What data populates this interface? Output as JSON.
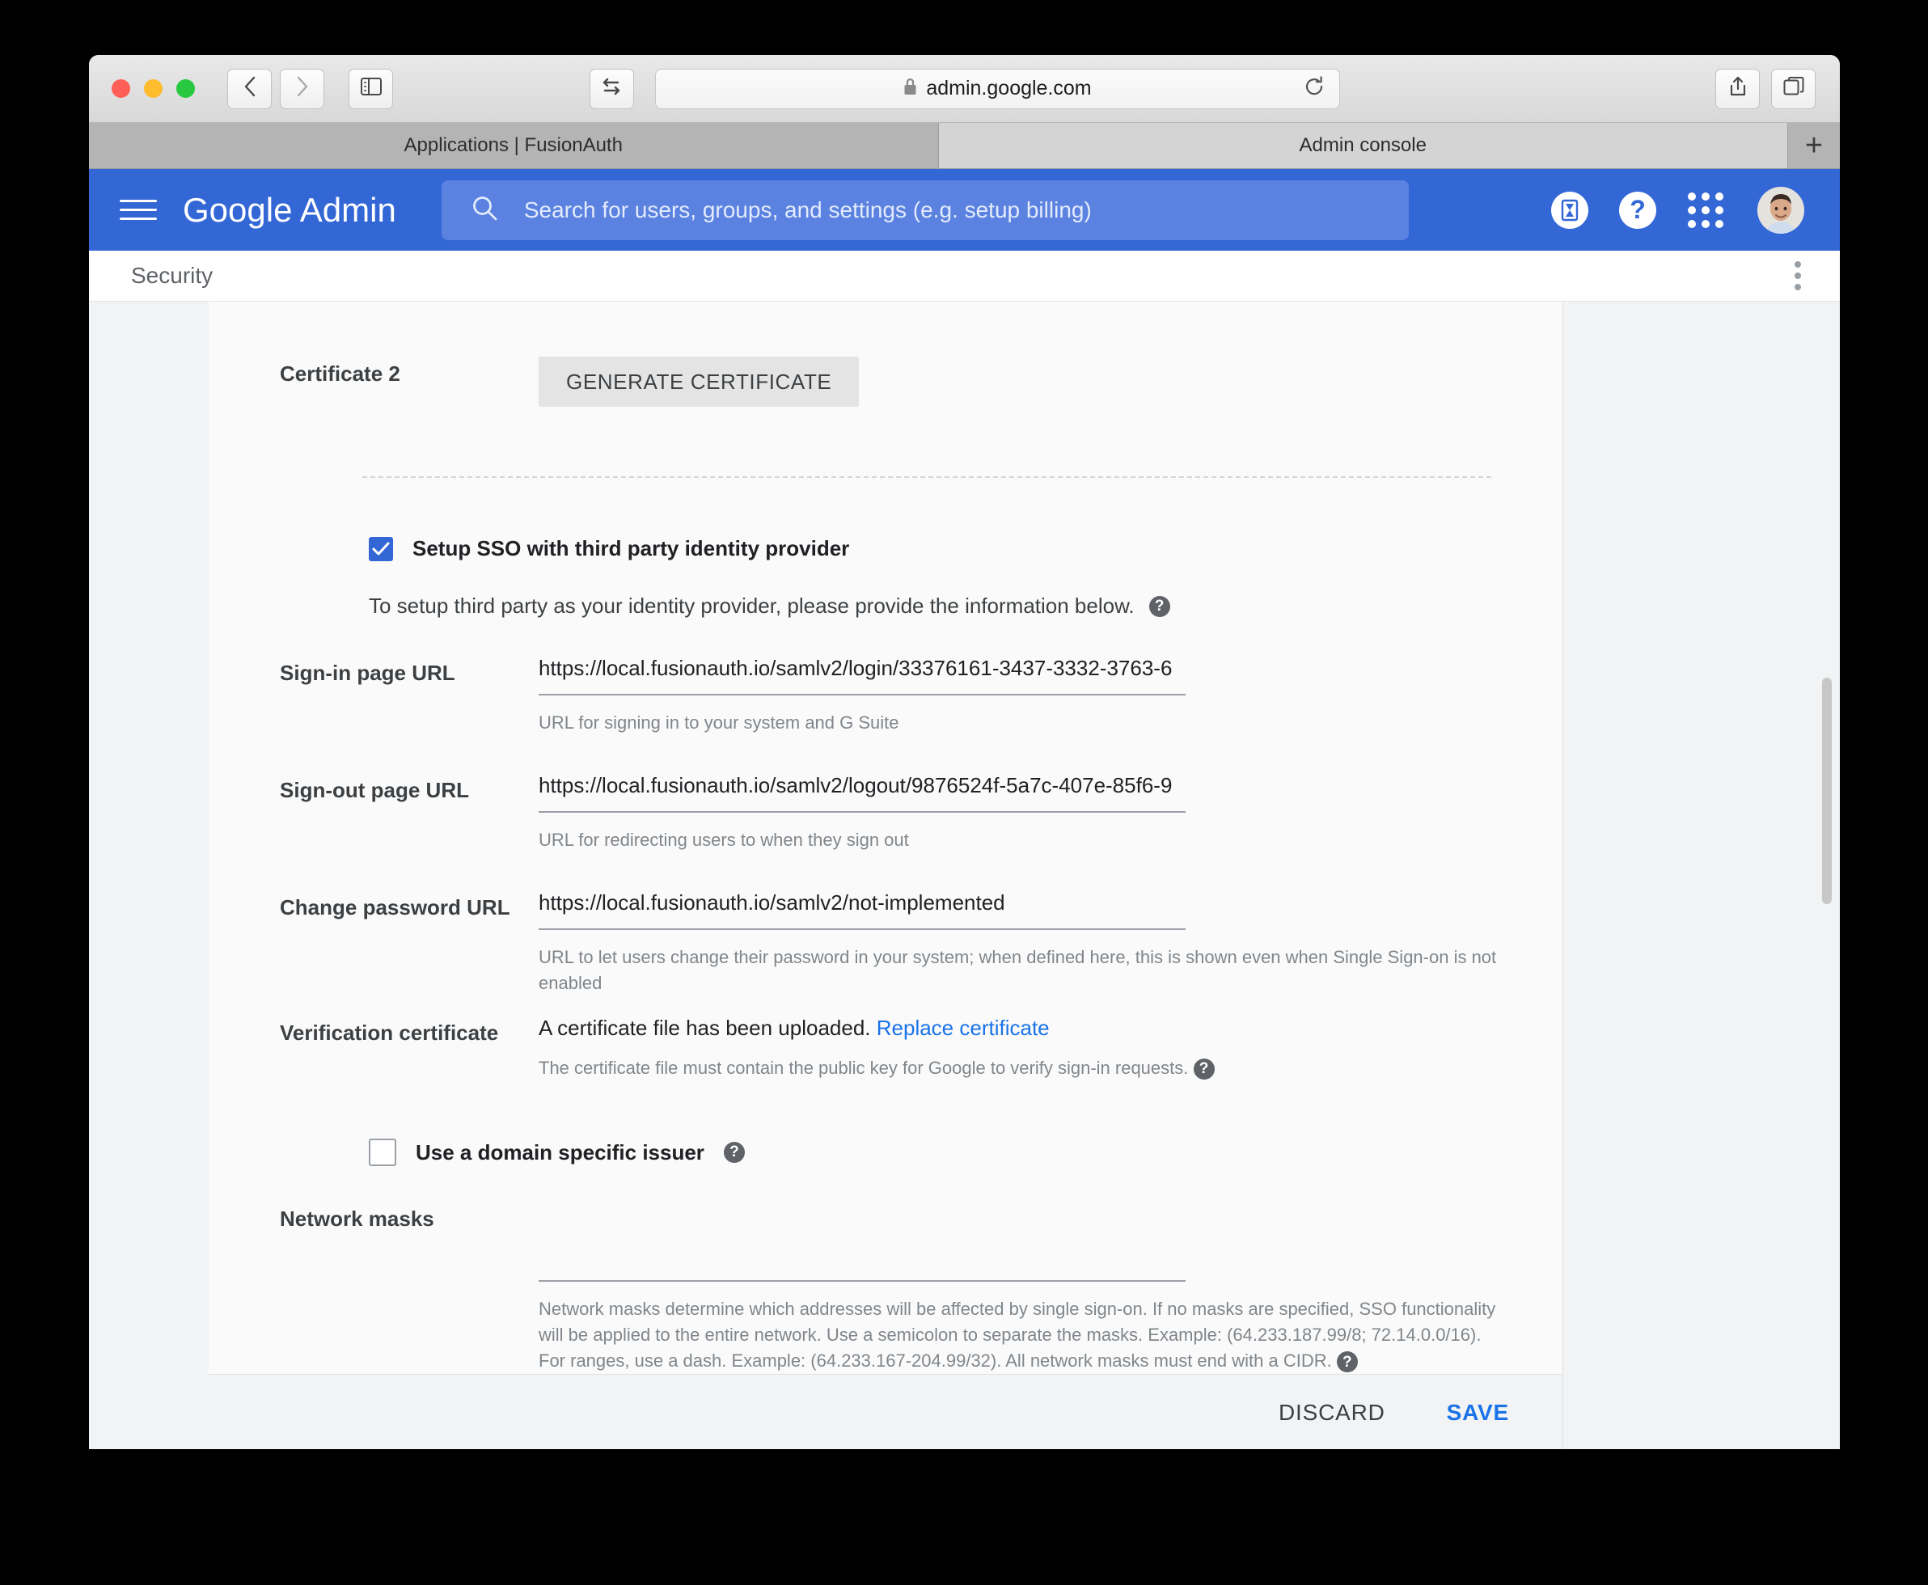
{
  "browser": {
    "address": "admin.google.com",
    "lock_icon": "lock-icon",
    "back_icon": "chevron-left-icon",
    "forward_icon": "chevron-right-icon",
    "sidebar_icon": "sidebar-toggle-icon",
    "swap_icon": "swap-arrows-icon",
    "reload_icon": "reload-icon",
    "share_icon": "share-icon",
    "newtab_window_icon": "new-window-icon",
    "new_tab_label": "+",
    "tabs": [
      {
        "label": "Applications | FusionAuth",
        "active": false
      },
      {
        "label": "Admin console",
        "active": true
      }
    ]
  },
  "app_header": {
    "menu_icon": "hamburger-menu-icon",
    "brand_bold": "Google",
    "brand_thin": "Admin",
    "search": {
      "icon": "search-icon",
      "placeholder": "Search for users, groups, and settings (e.g. setup billing)",
      "value": ""
    },
    "trial_icon": "hourglass-icon",
    "help_icon": "help-icon",
    "apps_icon": "apps-grid-icon",
    "avatar_icon": "user-avatar"
  },
  "subheader": {
    "title": "Security",
    "overflow_icon": "more-vertical-icon"
  },
  "form": {
    "certificate": {
      "label": "Certificate 2",
      "button_label": "GENERATE CERTIFICATE"
    },
    "sso_checkbox": {
      "label": "Setup SSO with third party identity provider",
      "checked": true
    },
    "intro": {
      "text": "To setup third party as your identity provider, please provide the information below.",
      "help_icon": "help-icon",
      "help_glyph": "?"
    },
    "signin": {
      "label": "Sign-in page URL",
      "value": "https://local.fusionauth.io/samlv2/login/33376161-3437-3332-3763-6",
      "hint": "URL for signing in to your system and G Suite"
    },
    "signout": {
      "label": "Sign-out page URL",
      "value": "https://local.fusionauth.io/samlv2/logout/9876524f-5a7c-407e-85f6-9",
      "hint": "URL for redirecting users to when they sign out"
    },
    "change_password": {
      "label": "Change password URL",
      "value": "https://local.fusionauth.io/samlv2/not-implemented",
      "hint": "URL to let users change their password in your system; when defined here, this is shown even when Single Sign-on is not enabled"
    },
    "verification_certificate": {
      "label": "Verification certificate",
      "status_text": "A certificate file has been uploaded.",
      "link_text": "Replace certificate",
      "hint": "The certificate file must contain the public key for Google to verify sign-in requests.",
      "help_glyph": "?"
    },
    "domain_issuer": {
      "label": "Use a domain specific issuer",
      "checked": false,
      "help_glyph": "?"
    },
    "network_masks": {
      "label": "Network masks",
      "value": "",
      "hint": "Network masks determine which addresses will be affected by single sign-on. If no masks are specified, SSO functionality will be applied to the entire network. Use a semicolon to separate the masks. Example: (64.233.187.99/8; 72.14.0.0/16). For ranges, use a dash. Example: (64.233.167-204.99/32). All network masks must end with a CIDR.",
      "help_glyph": "?"
    }
  },
  "footer": {
    "discard_label": "DISCARD",
    "save_label": "SAVE"
  },
  "colors": {
    "brand_blue": "#3367d6",
    "link_blue": "#1a73e8",
    "page_bg": "#f1f3f4",
    "card_bg": "#fafafa"
  }
}
